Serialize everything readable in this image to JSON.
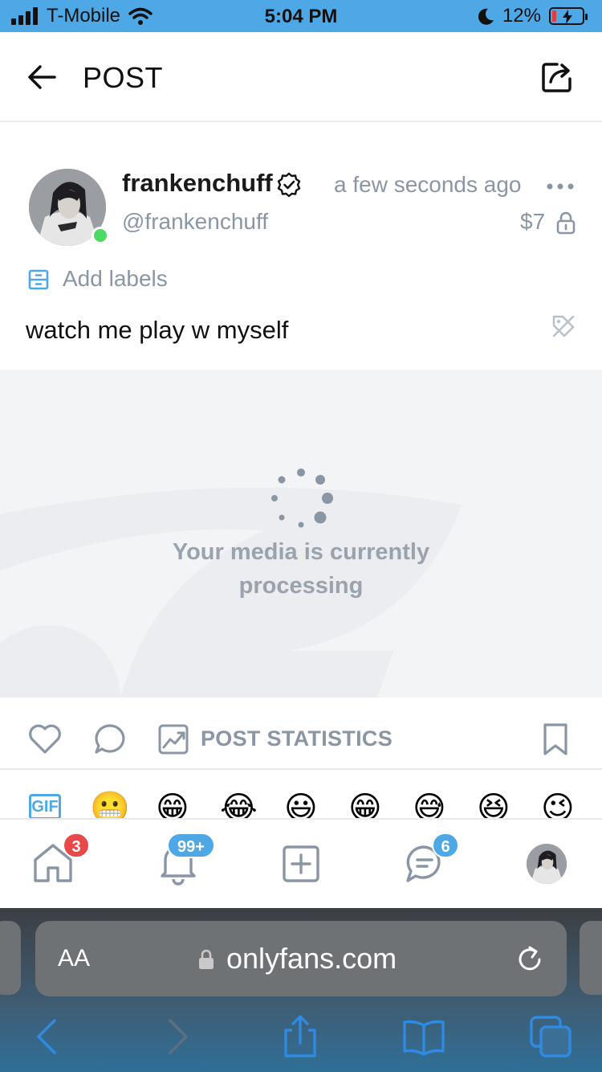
{
  "status_bar": {
    "carrier": "T-Mobile",
    "time": "5:04 PM",
    "battery": "12%",
    "battery_level": 0.12
  },
  "header": {
    "title": "POST"
  },
  "post": {
    "display_name": "frankenchuff",
    "username": "@frankenchuff",
    "timestamp": "a few seconds ago",
    "price": "$7",
    "add_labels": "Add labels",
    "text": "watch me play w myself",
    "media_status_line1": "Your media is currently",
    "media_status_line2": "processing"
  },
  "actions": {
    "statistics_label": "POST STATISTICS"
  },
  "emoji_bar": {
    "gif_label": "GIF",
    "emojis": [
      "😬",
      "😁",
      "😂",
      "😃",
      "😁",
      "😅",
      "😆",
      "😉"
    ]
  },
  "bottom_nav": {
    "home_badge": "3",
    "notifications_badge": "99+",
    "messages_badge": "6"
  },
  "browser": {
    "aa_label": "AA",
    "url": "onlyfans.com"
  },
  "colors": {
    "accent": "#00aff0",
    "status_bar": "#4fa8e6",
    "muted_text": "#8a96a3",
    "badge_red": "#e84a4a",
    "badge_blue": "#4fa8e6",
    "online": "#4cd964"
  }
}
